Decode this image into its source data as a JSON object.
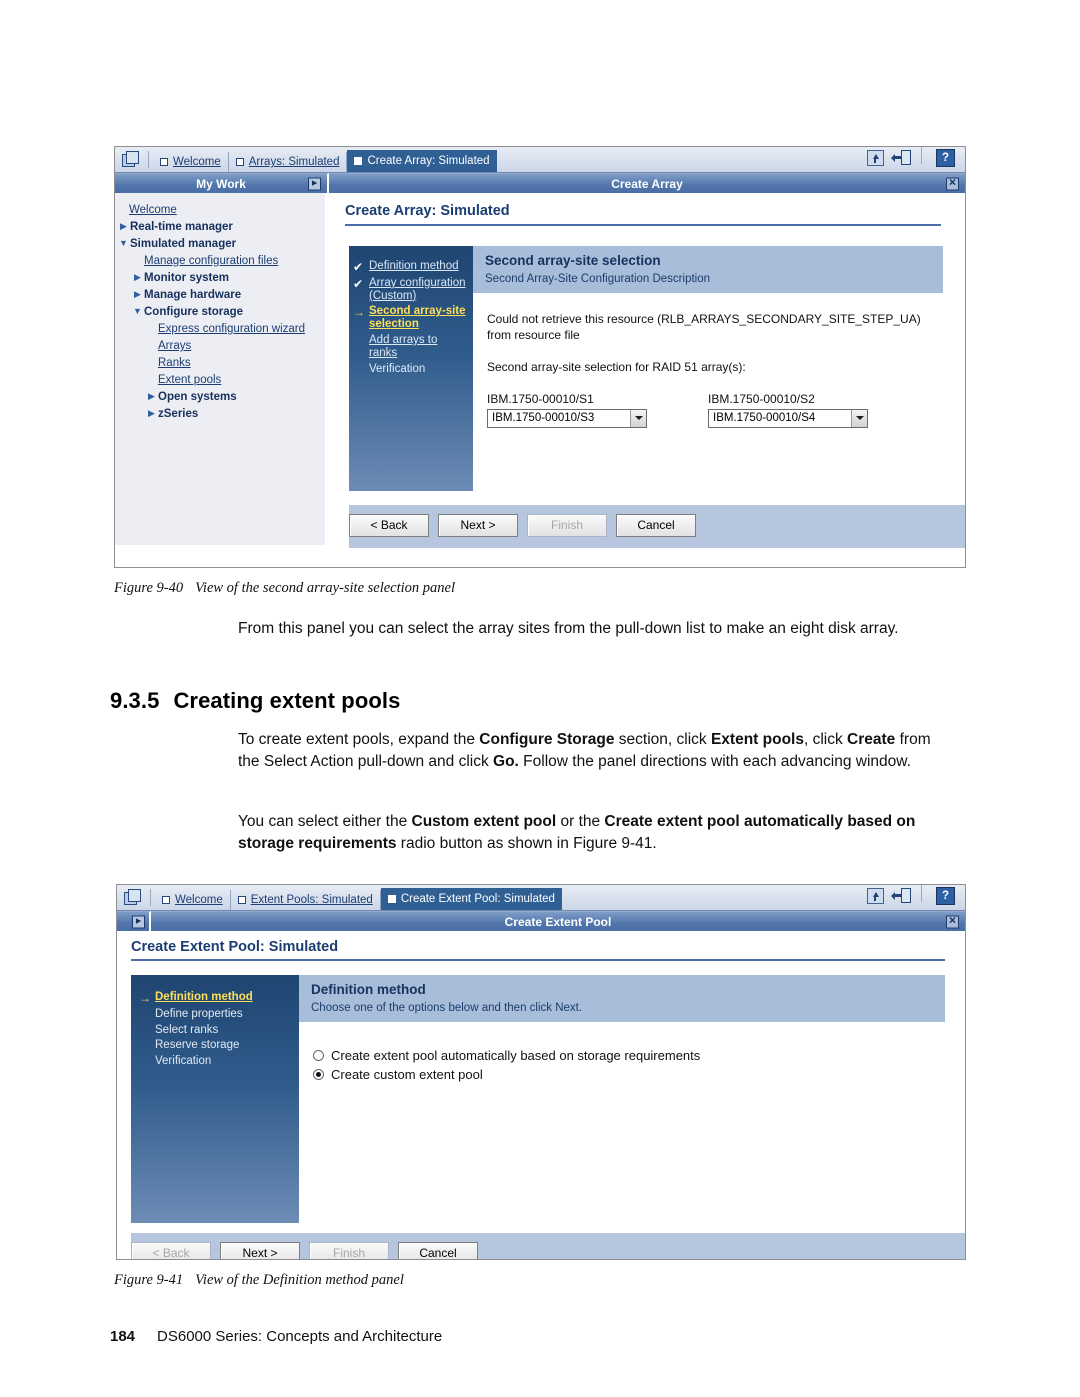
{
  "figure1": {
    "tabs": [
      {
        "label": "Welcome",
        "active": false
      },
      {
        "label": "Arrays: Simulated",
        "active": false
      },
      {
        "label": "Create Array: Simulated",
        "active": true
      }
    ],
    "toolbar_icons": [
      "export-icon",
      "exit-icon",
      "help-icon"
    ],
    "help_label": "?",
    "bands": {
      "left": "My Work",
      "right": "Create Array",
      "expand_label": "▸",
      "close_label": "✕"
    },
    "nav_items": [
      {
        "label": "Welcome",
        "arrow": "",
        "style": "link",
        "indent": 0
      },
      {
        "label": "Real-time manager",
        "arrow": "▶",
        "style": "bold",
        "indent": 0
      },
      {
        "label": "Simulated manager",
        "arrow": "▼",
        "style": "bold",
        "indent": 0
      },
      {
        "label": "Manage configuration files",
        "arrow": "",
        "style": "link",
        "indent": 1
      },
      {
        "label": "Monitor system",
        "arrow": "▶",
        "style": "bold",
        "indent": 1
      },
      {
        "label": "Manage hardware",
        "arrow": "▶",
        "style": "bold",
        "indent": 1
      },
      {
        "label": "Configure storage",
        "arrow": "▼",
        "style": "bold",
        "indent": 1
      },
      {
        "label": "Express configuration wizard",
        "arrow": "",
        "style": "link",
        "indent": 2
      },
      {
        "label": "Arrays",
        "arrow": "",
        "style": "link",
        "indent": 2
      },
      {
        "label": "Ranks",
        "arrow": "",
        "style": "link",
        "indent": 2
      },
      {
        "label": "Extent pools",
        "arrow": "",
        "style": "link",
        "indent": 2
      },
      {
        "label": "Open systems",
        "arrow": "▶",
        "style": "bold",
        "indent": 2
      },
      {
        "label": "zSeries",
        "arrow": "▶",
        "style": "bold",
        "indent": 2
      }
    ],
    "page_title": "Create Array: Simulated",
    "steps": [
      {
        "label": "Definition method",
        "mark": "✔",
        "state": "done"
      },
      {
        "label": "Array configuration (Custom)",
        "mark": "✔",
        "state": "done"
      },
      {
        "label": "Second array-site selection",
        "mark": "→",
        "state": "current"
      },
      {
        "label": "Add arrays to ranks",
        "mark": "",
        "state": "link"
      },
      {
        "label": "Verification",
        "mark": "",
        "state": "plain"
      }
    ],
    "panel": {
      "heading": "Second array-site selection",
      "subheading": "Second Array-Site Configuration Description",
      "message": "Could not retrieve this resource (RLB_ARRAYS_SECONDARY_SITE_STEP_UA) from resource file",
      "prompt": "Second array-site selection for RAID 51 array(s):",
      "selects": [
        {
          "label": "IBM.1750-00010/S1",
          "value": "IBM.1750-00010/S3"
        },
        {
          "label": "IBM.1750-00010/S2",
          "value": "IBM.1750-00010/S4"
        }
      ]
    },
    "buttons": [
      {
        "label": "< Back",
        "disabled": false
      },
      {
        "label": "Next >",
        "disabled": false
      },
      {
        "label": "Finish",
        "disabled": true
      },
      {
        "label": "Cancel",
        "disabled": false
      }
    ],
    "caption": {
      "number": "Figure 9-40",
      "text": "View of the second array-site selection panel"
    }
  },
  "body_text": {
    "para1": "From this panel you can select the array sites from the pull-down list to make an eight disk array.",
    "section": {
      "number": "9.3.5",
      "title": "Creating extent pools"
    },
    "para2_a": "To create extent pools, expand the ",
    "para2_b1": "Configure Storage",
    "para2_c": " section, click ",
    "para2_b2": "Extent pools",
    "para2_d": ", click ",
    "para2_b3": "Create",
    "para2_e": " from the Select Action pull-down and click ",
    "para2_b4": "Go.",
    "para2_f": " Follow the panel directions with each advancing window.",
    "para3_a": "You can select either the ",
    "para3_b1": "Custom extent pool",
    "para3_c": " or the ",
    "para3_b2": "Create extent pool automatically based on storage requirements",
    "para3_d": " radio button as shown in Figure 9-41."
  },
  "figure2": {
    "tabs": [
      {
        "label": "Welcome",
        "active": false
      },
      {
        "label": "Extent Pools: Simulated",
        "active": false
      },
      {
        "label": "Create Extent Pool: Simulated",
        "active": true
      }
    ],
    "help_label": "?",
    "bands": {
      "right": "Create Extent Pool",
      "expand_label": "▸",
      "close_label": "✕"
    },
    "page_title": "Create Extent Pool: Simulated",
    "steps": [
      {
        "label": "Definition method",
        "mark": "→",
        "state": "current"
      },
      {
        "label": "Define properties",
        "mark": "",
        "state": "plain"
      },
      {
        "label": "Select ranks",
        "mark": "",
        "state": "plain"
      },
      {
        "label": "Reserve storage",
        "mark": "",
        "state": "plain"
      },
      {
        "label": "Verification",
        "mark": "",
        "state": "plain"
      }
    ],
    "panel": {
      "heading": "Definition method",
      "subheading": "Choose one of the options below and then click Next.",
      "options": [
        {
          "label": "Create extent pool automatically based on storage requirements",
          "selected": false
        },
        {
          "label": "Create custom extent pool",
          "selected": true
        }
      ]
    },
    "buttons": [
      {
        "label": "< Back",
        "disabled": true
      },
      {
        "label": "Next >",
        "disabled": false
      },
      {
        "label": "Finish",
        "disabled": true
      },
      {
        "label": "Cancel",
        "disabled": false
      }
    ],
    "caption": {
      "number": "Figure 9-41",
      "text": "View of the Definition method panel"
    }
  },
  "footer": {
    "page": "184",
    "title": "DS6000 Series: Concepts and Architecture"
  },
  "colors": {
    "tab_active_bg": "#305f94",
    "band_blue": "#4a6ea6",
    "wizard_sidebar_top": "#1f4571",
    "wizard_sidebar_bottom": "#6d8cb5",
    "panel_header": "#a8bdd9",
    "button_bar": "#b6c6de",
    "link_blue": "#1b3d73",
    "current_step_yellow": "#ffdf57"
  }
}
